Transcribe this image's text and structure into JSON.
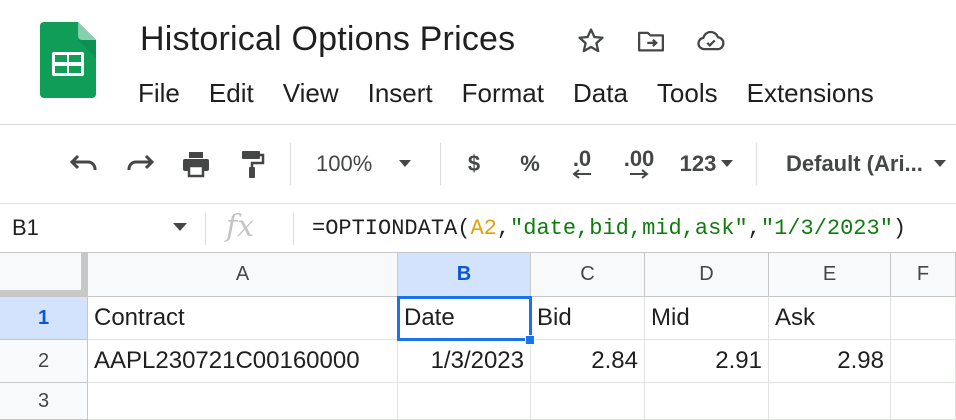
{
  "app": {
    "title": "Historical Options Prices",
    "brand_color": "#0F9D58"
  },
  "title_icons": [
    "star-icon",
    "move-to-folder-icon",
    "cloud-saved-icon"
  ],
  "menu": [
    "File",
    "Edit",
    "View",
    "Insert",
    "Format",
    "Data",
    "Tools",
    "Extensions"
  ],
  "toolbar": {
    "undo": "undo-icon",
    "redo": "redo-icon",
    "print": "print-icon",
    "paint_format": "paint-format-icon",
    "zoom": "100%",
    "currency": "$",
    "percent": "%",
    "decrease_decimal": ".0",
    "increase_decimal": ".00",
    "more_formats": "123",
    "font": "Default (Ari..."
  },
  "formula_bar": {
    "name_box": "B1",
    "fx": "fx",
    "formula_prefix": "=OPTIONDATA(",
    "formula_ref": "A2",
    "formula_sep1": ",",
    "formula_fields": "\"date,bid,mid,ask\"",
    "formula_sep2": ",",
    "formula_date": "\"1/3/2023\"",
    "formula_suffix": ")"
  },
  "grid": {
    "columns": [
      "A",
      "B",
      "C",
      "D",
      "E",
      "F"
    ],
    "rows": [
      "1",
      "2",
      "3"
    ],
    "selected_cell": "B1",
    "cells": {
      "A1": "Contract",
      "B1": "Date",
      "C1": "Bid",
      "D1": "Mid",
      "E1": "Ask",
      "A2": "AAPL230721C00160000",
      "B2": "1/3/2023",
      "C2": "2.84",
      "D2": "2.91",
      "E2": "2.98"
    }
  }
}
